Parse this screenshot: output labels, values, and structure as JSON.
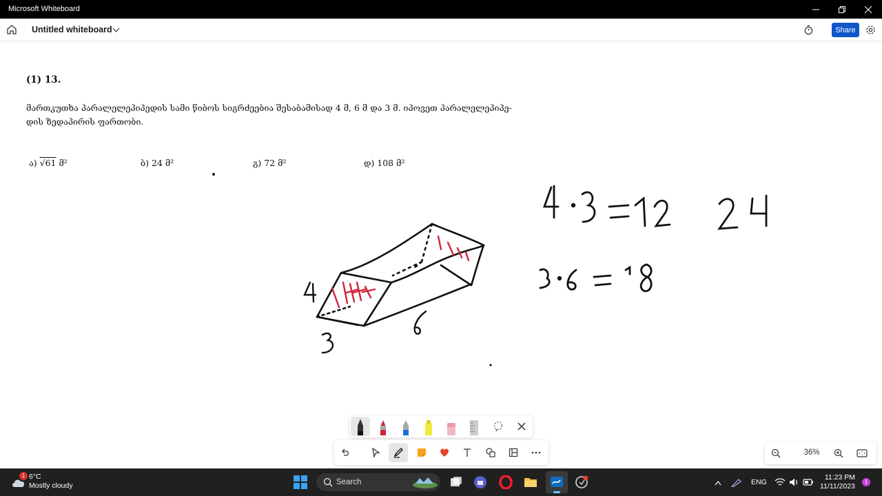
{
  "window": {
    "title": "Microsoft Whiteboard"
  },
  "appbar": {
    "board_name": "Untitled whiteboard",
    "share_label": "Share"
  },
  "problem": {
    "number": "(1) 13.",
    "text_line1": "მართკუთხა პარალელეპიპედის სამი წიბოს სიგრძეებია შესაბამისად 4 მ, 6 მ და 3 მ. იპოვეთ პარალელეპიპე-",
    "text_line2": "დის ზედაპირის ფართობი.",
    "answers": [
      {
        "label": "ა)",
        "root": "√61",
        "unit": "მ²"
      },
      {
        "label": "ბ)",
        "value": "24",
        "unit": "მ²"
      },
      {
        "label": "გ)",
        "value": "72",
        "unit": "მ²"
      },
      {
        "label": "დ)",
        "value": "108",
        "unit": "მ²"
      }
    ]
  },
  "handwriting": {
    "eq1": "4 · 3 = 12",
    "eq2": "3 · 6 = 18",
    "note": "24",
    "dims": [
      "4",
      "3",
      "6"
    ]
  },
  "toolbar": {
    "pens": [
      "black-pen-icon",
      "red-pen-icon",
      "blue-pen-icon",
      "highlighter-icon",
      "eraser-icon",
      "ruler-icon",
      "lasso-icon",
      "close-icon"
    ],
    "tools": [
      "undo-icon",
      "select-icon",
      "pen-tool-icon",
      "sticky-note-icon",
      "reaction-icon",
      "text-icon",
      "shapes-icon",
      "templates-icon",
      "more-icon"
    ]
  },
  "zoom": {
    "value": "36%"
  },
  "taskbar": {
    "temperature": "6°C",
    "weather_desc": "Mostly cloudy",
    "weather_badge": "1",
    "search_label": "Search",
    "language": "ENG",
    "time": "11:23 PM",
    "date": "11/11/2023",
    "notification_count": "1"
  }
}
